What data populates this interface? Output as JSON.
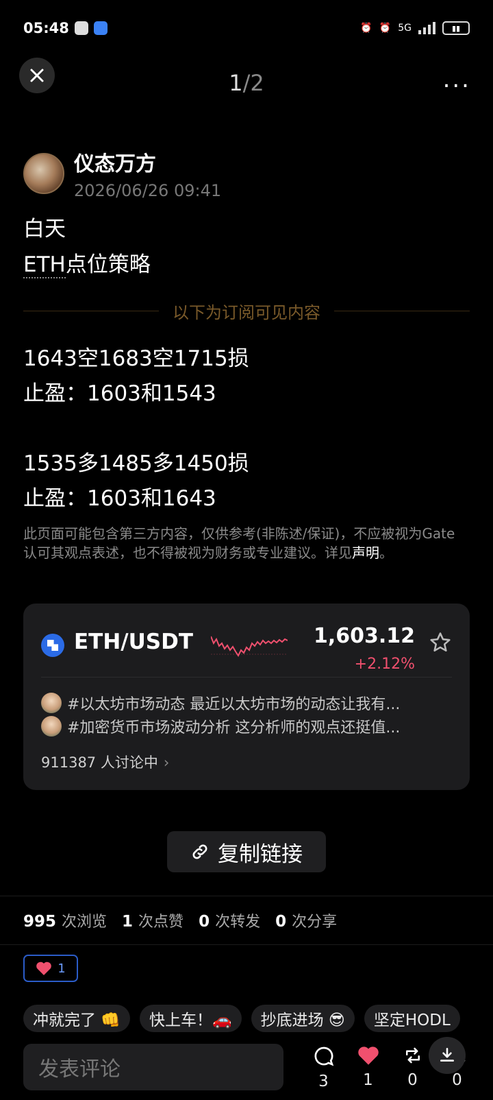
{
  "status_bar": {
    "time": "05:48",
    "network": "5G"
  },
  "header": {
    "page_current": "1",
    "page_total": "/2",
    "more": "..."
  },
  "author": {
    "name": "仪态万方",
    "time": "2026/06/26 09:41"
  },
  "post": {
    "line1": "白天",
    "line2_prefix": "ETH",
    "line2_rest": "点位策略",
    "subscriber_divider": "以下为订阅可见内容",
    "strategy_lines": [
      "1643空1683空1715损",
      "止盈：1603和1543",
      "1535多1485多1450损",
      "止盈：1603和1643"
    ],
    "disclaimer_text": "此页面可能包含第三方内容，仅供参考(非陈述/保证)，不应被视为Gate认可其观点表述，也不得被视为财务或专业建议。详见",
    "disclaimer_link": "声明",
    "disclaimer_end": "。"
  },
  "market_card": {
    "pair": "ETH/USDT",
    "price": "1,603.12",
    "change": "+2.12%",
    "change_color": "#f0506e",
    "topics": [
      "#以太坊市场动态 最近以太坊市场的动态让我有...",
      "#加密货币市场波动分析 这分析师的观点还挺值..."
    ],
    "discussing": "911387 人讨论中",
    "chevron": "›"
  },
  "copy_link": {
    "label": "复制链接"
  },
  "stats": {
    "views_count": "995",
    "views_label": "次浏览",
    "likes_count": "1",
    "likes_label": "次点赞",
    "reposts_count": "0",
    "reposts_label": "次转发",
    "shares_count": "0",
    "shares_label": "次分享"
  },
  "reaction": {
    "heart_count": "1"
  },
  "quick_replies": [
    "冲就完了 👊",
    "快上车！🚗",
    "抄底进场 😎",
    "坚定HODL"
  ],
  "comment_bar": {
    "placeholder": "发表评论",
    "comments": "3",
    "likes": "1",
    "reposts": "0",
    "downloads": "0"
  },
  "colors": {
    "accent_blue": "#2b6be6",
    "gold_divider": "#7a5a2a",
    "red": "#f0506e"
  }
}
